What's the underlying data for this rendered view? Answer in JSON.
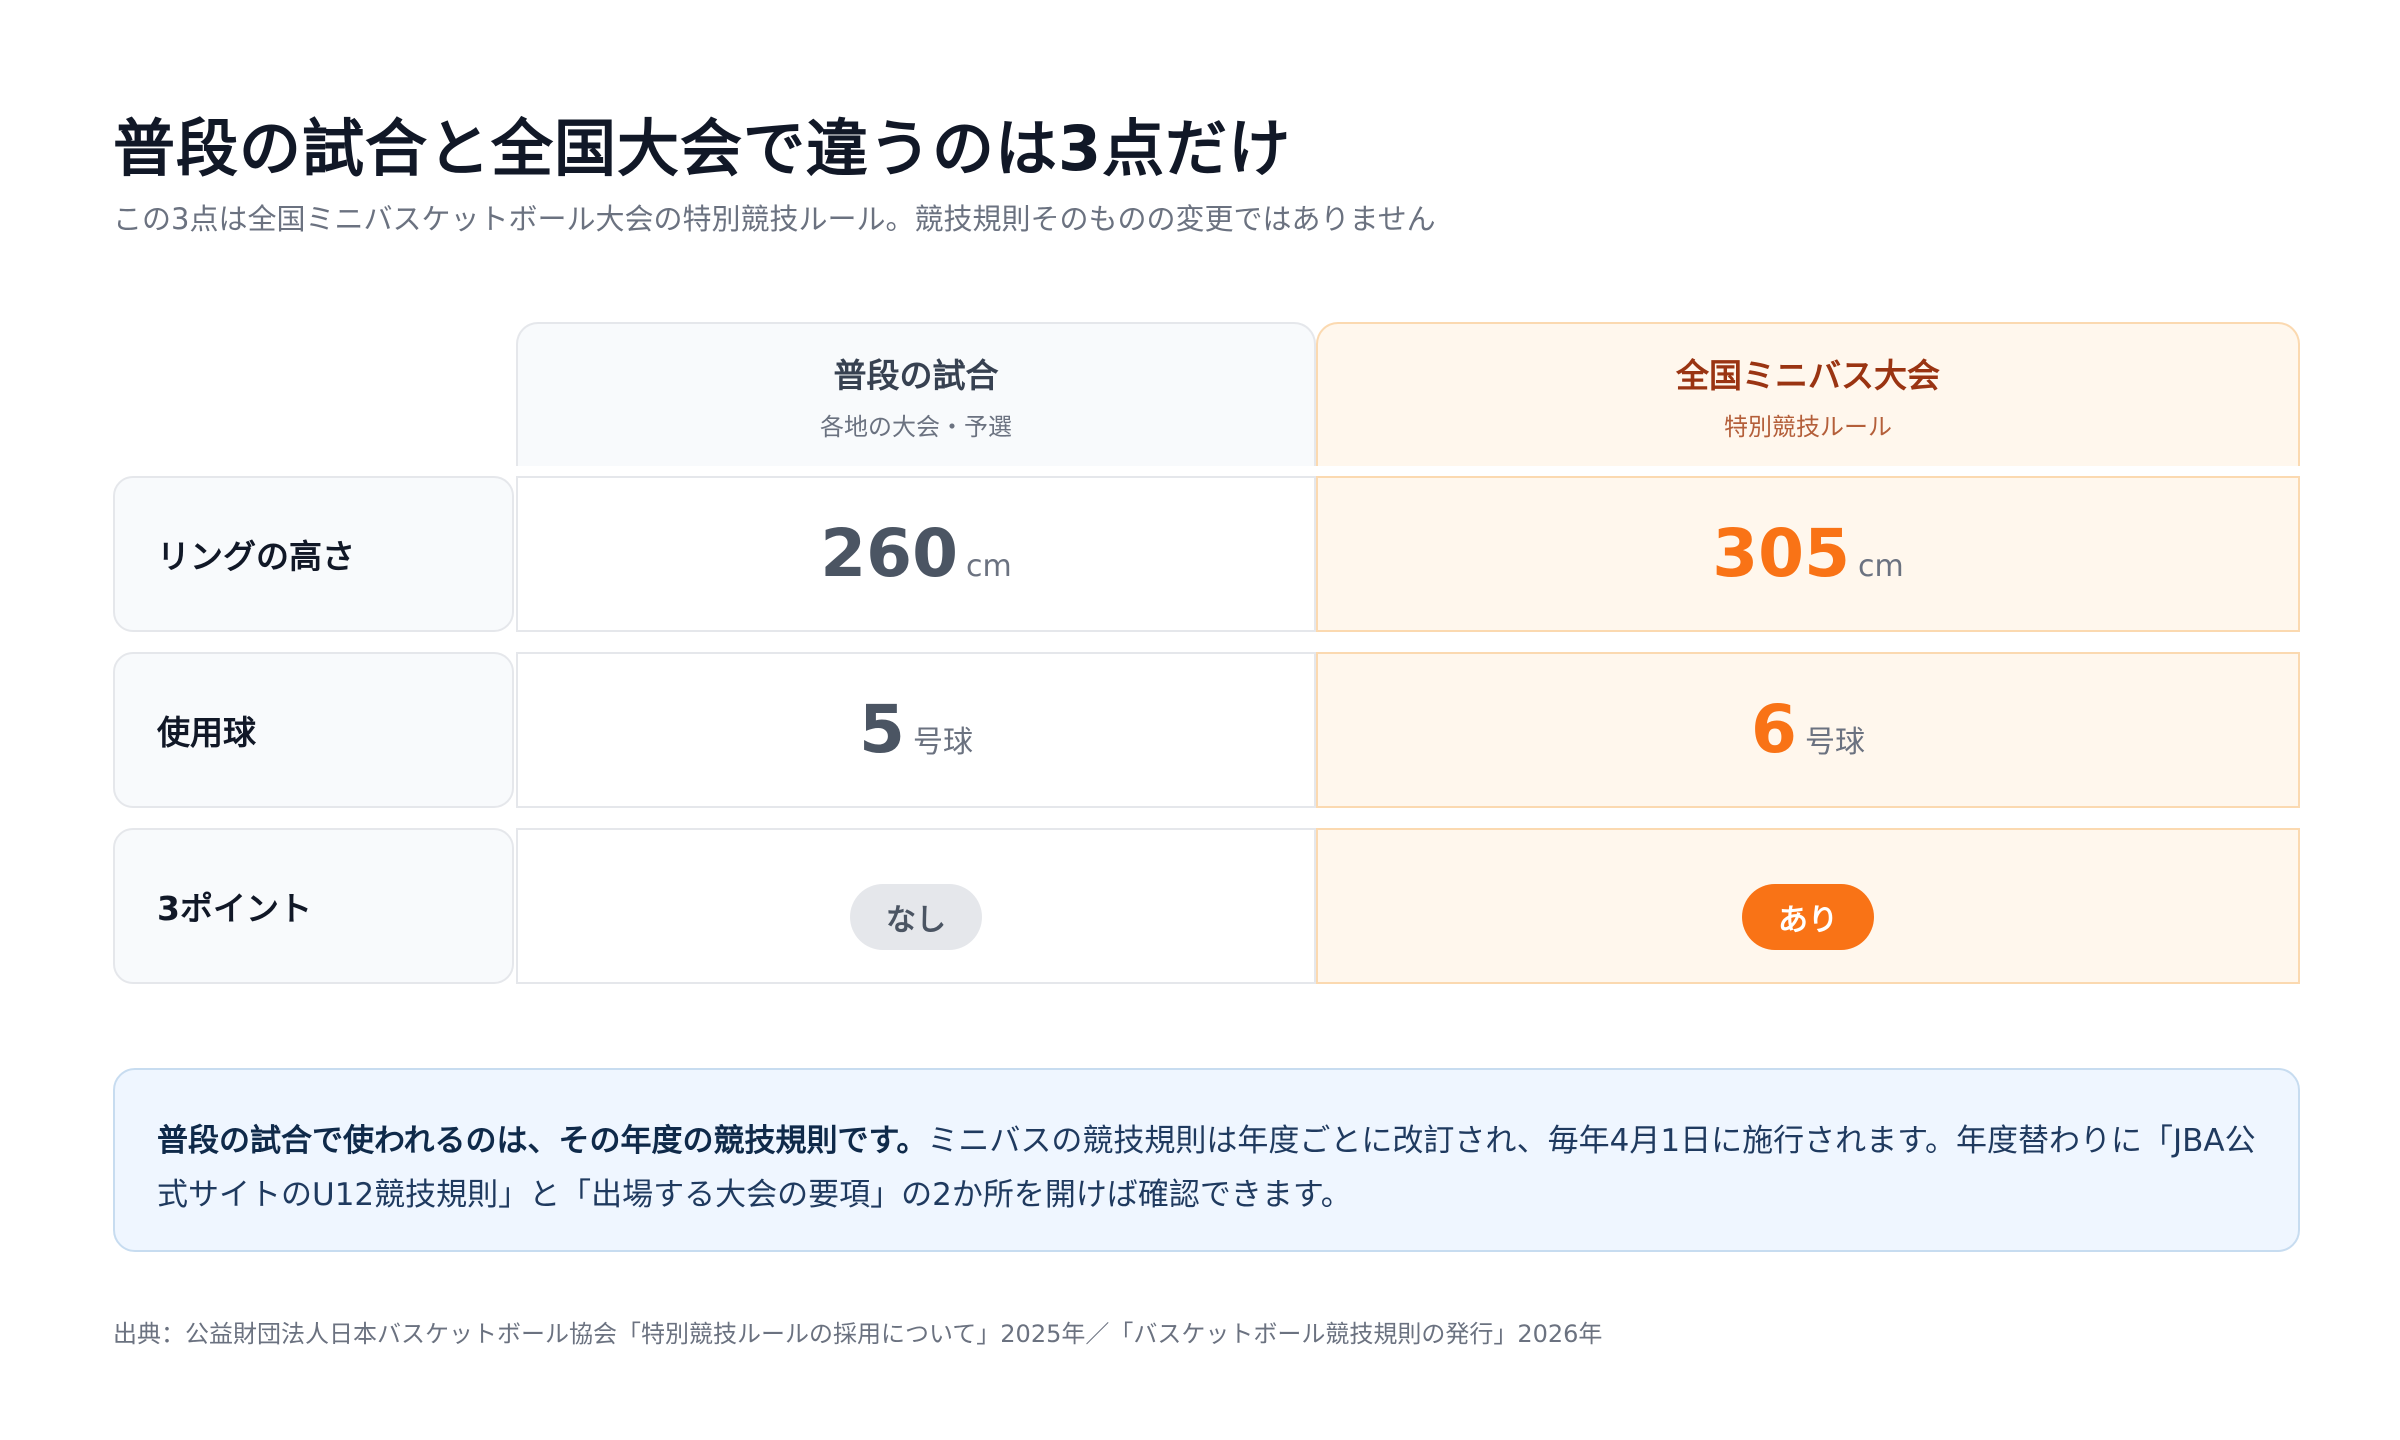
{
  "title": "普段の試合と全国大会で違うのは3点だけ",
  "subtitle": "この3点は全国ミニバスケットボール大会の特別競技ルール。競技規則そのものの変更ではありません",
  "columns": {
    "normal": {
      "label": "普段の試合",
      "sub": "各地の大会・予選"
    },
    "national": {
      "label": "全国ミニバス大会",
      "sub": "特別競技ルール"
    }
  },
  "rows": [
    {
      "label": "リングの高さ",
      "normal_value": "260",
      "normal_unit": "cm",
      "national_value": "305",
      "national_unit": "cm"
    },
    {
      "label": "使用球",
      "normal_value": "5",
      "normal_unit": "号球",
      "national_value": "6",
      "national_unit": "号球"
    },
    {
      "label": "3ポイント",
      "normal_value": "なし",
      "national_value": "あり"
    }
  ],
  "note": {
    "lead": "普段の試合で使われるのは、その年度の競技規則です。",
    "body": "ミニバスの競技規則は年度ごとに改訂され、毎年4月1日に施行されます。年度替わりに「JBA公式サイトのU12競技規則」と「出場する大会の要項」の2か所を開けば確認できます。"
  },
  "source": "出典：公益財団法人日本バスケットボール協会「特別競技ルールの採用について」2025年／「バスケットボール競技規則の発行」2026年",
  "colors": {
    "accent": "#f97316",
    "national_bg": "#fff7ed",
    "note_bg": "#eff6ff"
  }
}
